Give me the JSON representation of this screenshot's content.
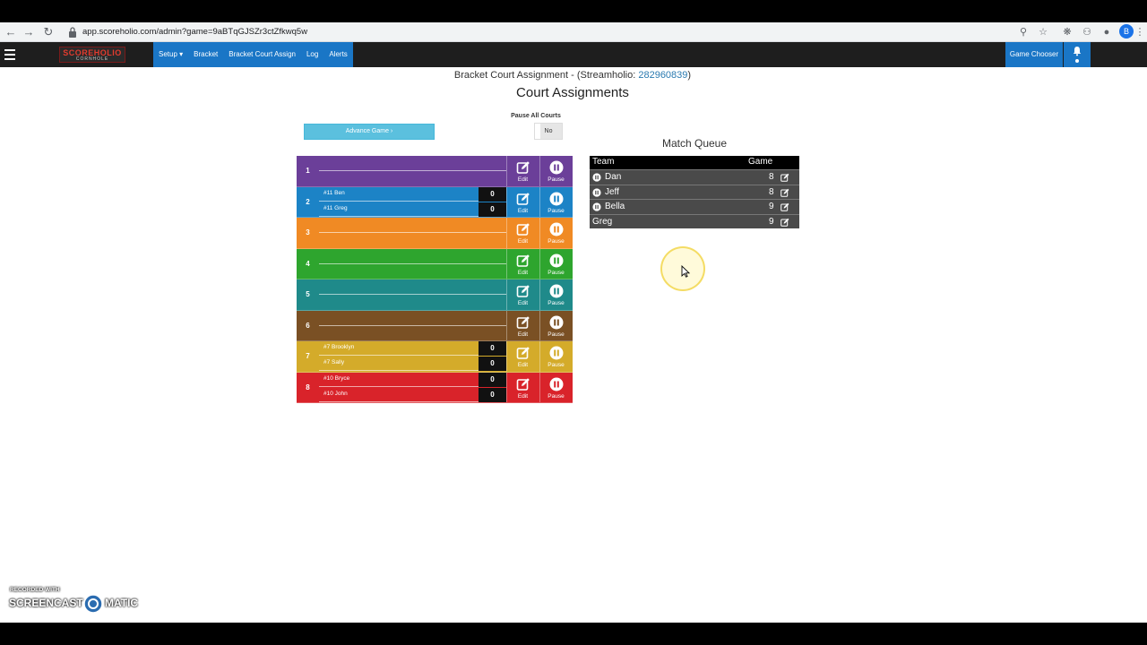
{
  "browser": {
    "url": "app.scoreholio.com/admin?game=9aBTqGJSZr3ctZfkwq5w",
    "profile_initial": "B"
  },
  "navbar": {
    "logo_top": "SCOREHOLIO",
    "logo_bottom": "CORNHOLE",
    "menu": [
      "Setup ▾",
      "Bracket",
      "Bracket Court Assign",
      "Log",
      "Alerts"
    ],
    "game_chooser": "Game Chooser"
  },
  "header": {
    "subtitle_prefix": "Bracket Court Assignment - (Streamholio: ",
    "stream_id": "282960839",
    "subtitle_suffix": ")",
    "title": "Court Assignments"
  },
  "controls": {
    "advance_label": "Advance Game ›",
    "pause_all_label": "Pause All Courts",
    "pause_all_value": "No"
  },
  "courts": [
    {
      "number": "1",
      "color": "#6b3f99",
      "teams": []
    },
    {
      "number": "2",
      "color": "#1c83c6",
      "teams": [
        {
          "name": "#11 Ben",
          "score": "0"
        },
        {
          "name": "#11 Greg",
          "score": "0"
        }
      ]
    },
    {
      "number": "3",
      "color": "#f08a24",
      "teams": []
    },
    {
      "number": "4",
      "color": "#2ea52e",
      "teams": []
    },
    {
      "number": "5",
      "color": "#1f8a8a",
      "teams": []
    },
    {
      "number": "6",
      "color": "#7a5024",
      "teams": []
    },
    {
      "number": "7",
      "color": "#d4ab2a",
      "teams": [
        {
          "name": "#7 Brooklyn",
          "score": "0"
        },
        {
          "name": "#7 Sally",
          "score": "0"
        }
      ]
    },
    {
      "number": "8",
      "color": "#d9232a",
      "teams": [
        {
          "name": "#10 Bryce",
          "score": "0"
        },
        {
          "name": "#10 John",
          "score": "0"
        }
      ]
    }
  ],
  "court_buttons": {
    "edit": "Edit",
    "pause": "Pause"
  },
  "queue": {
    "title": "Match Queue",
    "col_team": "Team",
    "col_game": "Game",
    "rows": [
      {
        "team": "Dan",
        "game": "8",
        "paused": true
      },
      {
        "team": "Jeff",
        "game": "8",
        "paused": true
      },
      {
        "team": "Bella",
        "game": "9",
        "paused": true
      },
      {
        "team": "Greg",
        "game": "9",
        "paused": false
      }
    ]
  },
  "watermark": {
    "top": "RECORDED WITH",
    "main": "SCREENCAST",
    "tail": "MATIC"
  }
}
